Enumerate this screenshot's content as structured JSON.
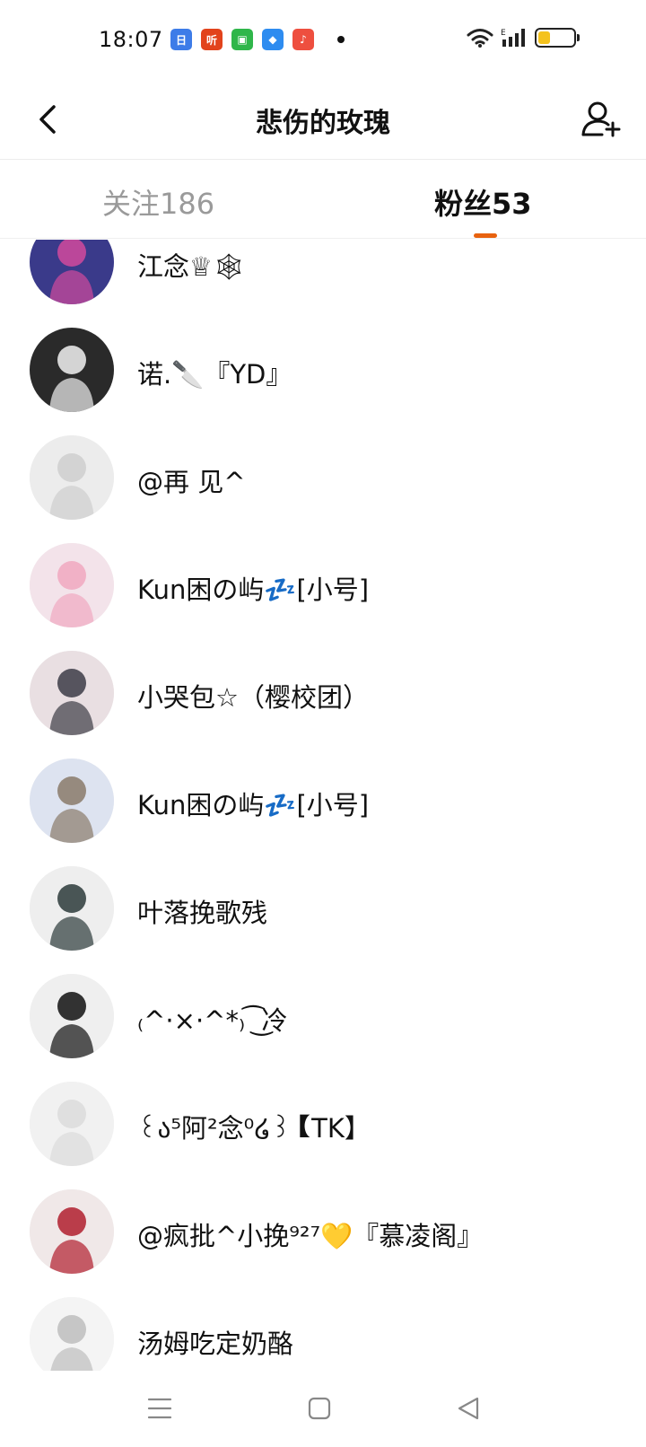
{
  "status": {
    "time": "18:07",
    "app_icons": [
      {
        "name": "calendar-app-icon",
        "glyph": "日",
        "color": "#3d7ce8"
      },
      {
        "name": "listen-app-icon",
        "glyph": "听",
        "color": "#e2431c"
      },
      {
        "name": "android-app-icon",
        "glyph": "▣",
        "color": "#2fb64a"
      },
      {
        "name": "feather-app-icon",
        "glyph": "◆",
        "color": "#2e8cf0"
      },
      {
        "name": "music-app-icon",
        "glyph": "♪",
        "color": "#ee4f3f"
      }
    ],
    "battery_level": 0.35
  },
  "header": {
    "title": "悲伤的玫瑰"
  },
  "tabs": [
    {
      "label": "关注186",
      "active": false
    },
    {
      "label": "粉丝53",
      "active": true
    }
  ],
  "colors": {
    "accent": "#e8620f",
    "inactive_tab": "#9a9a9a"
  },
  "fans": [
    {
      "name": "江念♕🕸",
      "avatar_bg": "#3a3a8a",
      "avatar_fg": "#d24a9c"
    },
    {
      "name": "诺.🔪『YD』",
      "avatar_bg": "#2a2a2a",
      "avatar_fg": "#f2f2f2"
    },
    {
      "name": "@再   见^",
      "avatar_bg": "#ececec",
      "avatar_fg": "#cfcfcf"
    },
    {
      "name": "Kun困の屿💤[小号]",
      "avatar_bg": "#f3e3ea",
      "avatar_fg": "#f0a8c0"
    },
    {
      "name": "小哭包☆（樱校团）",
      "avatar_bg": "#e9dfe2",
      "avatar_fg": "#3c3c46"
    },
    {
      "name": "Kun困の屿💤[小号]",
      "avatar_bg": "#dde3f0",
      "avatar_fg": "#8a7a6a"
    },
    {
      "name": "叶落挽歌残",
      "avatar_bg": "#eeeeee",
      "avatar_fg": "#2c3a3a"
    },
    {
      "name": "₍^·×·^*₎ ͡ ͜冷",
      "avatar_bg": "#efefef",
      "avatar_fg": "#111111"
    },
    {
      "name": "꒰ა⁵阿²念⁰໒꒱【TK】",
      "avatar_bg": "#f1f1f1",
      "avatar_fg": "#dcdcdc"
    },
    {
      "name": "@疯批^小挽⁹²⁷💛『慕凌阁』",
      "avatar_bg": "#f0e8e8",
      "avatar_fg": "#b01e2e"
    },
    {
      "name": "汤姆吃定奶酪",
      "avatar_bg": "#f4f4f4",
      "avatar_fg": "#bdbdbd"
    }
  ]
}
